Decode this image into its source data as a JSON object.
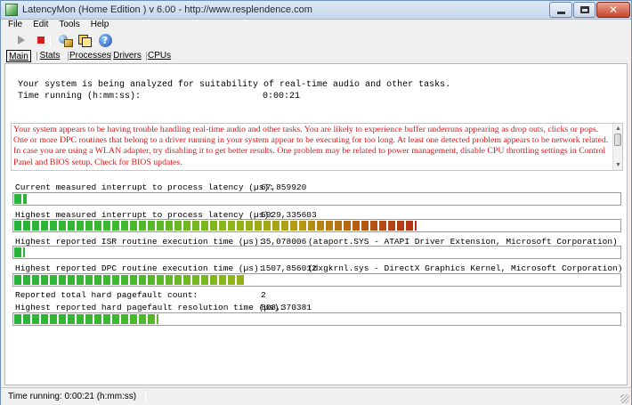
{
  "window": {
    "title": "LatencyMon  (Home Edition )  v 6.00 - http://www.resplendence.com",
    "close_glyph": "✕"
  },
  "menu": [
    "File",
    "Edit",
    "Tools",
    "Help"
  ],
  "toolbar": {
    "icons": [
      "play-icon",
      "stop-icon",
      "reset-icon",
      "copy-icon",
      "help-icon"
    ],
    "help_glyph": "?"
  },
  "tabs": [
    {
      "label": "Main",
      "active": true
    },
    {
      "label": "Stats",
      "active": false
    },
    {
      "label": "Processes",
      "active": false
    },
    {
      "label": "Drivers",
      "active": false
    },
    {
      "label": "CPUs",
      "active": false
    }
  ],
  "main": {
    "summary": "Your system is being analyzed for suitability of real-time audio and other tasks.",
    "running_label": "Time running (h:mm:ss):",
    "running_value": "0:00:21",
    "conclusion": "Your system appears to be having trouble handling real-time audio and other tasks. You are likely to experience buffer underruns appearing as drop outs, clicks or pops. One or more DPC routines that belong to a driver running in your system appear to be executing for too long. At least one detected problem appears to be network related. In case you are using a WLAN adapter, try disabling it to get better results. One problem may be related to power management, disable CPU throttling settings in Control Panel and BIOS setup. Check for BIOS updates.",
    "conclusion_color": "#e2171a",
    "metrics": [
      {
        "label": "Current measured interrupt to process latency (µs):",
        "value": "67,859920",
        "driver": "",
        "meter_level": 0.02
      },
      {
        "label": "Highest measured interrupt to process latency (µs):",
        "value": "5929,335603",
        "driver": "",
        "meter_level": 0.665
      },
      {
        "label": "Highest reported ISR routine execution time (µs):",
        "value": "35,078006",
        "driver": "(ataport.SYS - ATAPI Driver Extension, Microsoft Corporation)",
        "meter_level": 0.018
      },
      {
        "label": "Highest reported DPC routine execution time (µs):",
        "value": "1507,856012",
        "driver": "(dxgkrnl.sys - DirectX Graphics Kernel, Microsoft Corporation)",
        "meter_level": 0.38
      },
      {
        "label": "Reported total hard pagefault count:",
        "value": "2",
        "driver": "",
        "meter_level": null
      },
      {
        "label": "Highest reported hard pagefault resolution time (µs):",
        "value": "808,370381",
        "driver": "",
        "meter_level": 0.238
      }
    ]
  },
  "status": {
    "text": "Time running: 0:00:21  (h:mm:ss)"
  },
  "colors": {
    "meter_green": "#28b43a",
    "meter_red": "#a5141a",
    "titlebar": "#c6d7ec"
  }
}
